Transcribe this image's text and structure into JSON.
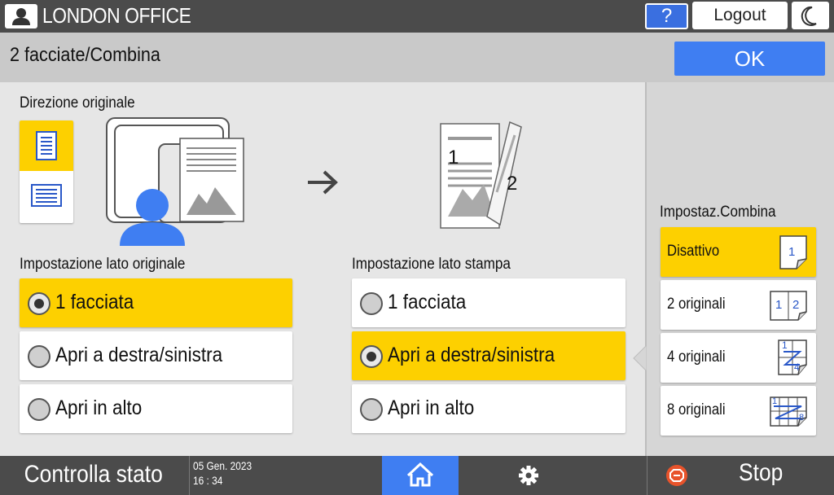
{
  "header": {
    "office_name": "LONDON OFFICE",
    "help_label": "?",
    "logout_label": "Logout"
  },
  "title_bar": {
    "title": "2 facciate/Combina",
    "ok_label": "OK"
  },
  "original_direction": {
    "label": "Direzione originale"
  },
  "original_side": {
    "label": "Impostazione lato originale",
    "options": [
      {
        "label": "1 facciata",
        "selected": true
      },
      {
        "label": "Apri a destra/sinistra",
        "selected": false
      },
      {
        "label": "Apri in alto",
        "selected": false
      }
    ]
  },
  "print_side": {
    "label": "Impostazione lato stampa",
    "options": [
      {
        "label": "1 facciata",
        "selected": false
      },
      {
        "label": "Apri a destra/sinistra",
        "selected": true
      },
      {
        "label": "Apri in alto",
        "selected": false
      }
    ],
    "preview_page_1": "1",
    "preview_page_2": "2"
  },
  "combine": {
    "label": "Impostaz.Combina",
    "options": [
      {
        "label": "Disattivo",
        "selected": true,
        "icon": "1"
      },
      {
        "label": "2 originali",
        "selected": false,
        "icon_a": "1",
        "icon_b": "2"
      },
      {
        "label": "4 originali",
        "selected": false,
        "icon_a": "1",
        "icon_b": "4"
      },
      {
        "label": "8 originali",
        "selected": false,
        "icon_a": "1",
        "icon_b": "8"
      }
    ]
  },
  "footer": {
    "status_label": "Controlla stato",
    "date": "05 Gen. 2023",
    "time": "16 : 34",
    "stop_label": "Stop"
  },
  "colors": {
    "selected": "#fdd000",
    "accent_blue": "#3f7ef2",
    "bar_dark": "#4b4b4b",
    "stop_red": "#e8532b"
  }
}
